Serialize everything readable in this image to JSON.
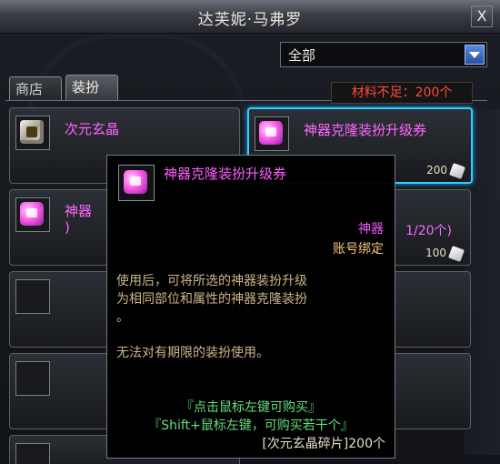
{
  "window": {
    "title": "达芙妮·马弗罗",
    "close_label": "X"
  },
  "filter": {
    "selected": "全部"
  },
  "tabs": [
    {
      "label": "商店",
      "active": false
    },
    {
      "label": "装扮",
      "active": true
    }
  ],
  "materials": {
    "status": "材料不足：200个"
  },
  "items": [
    {
      "name": "次元玄晶",
      "icon": "crystal-icon",
      "price": null
    },
    {
      "name": "神器克隆装扮升级券",
      "icon": "ticket-icon",
      "price": "200"
    },
    {
      "name_line1": "神器",
      "name_line2": ")",
      "icon": "ticket-icon",
      "sub": "1/20个)",
      "price": "100"
    }
  ],
  "tooltip": {
    "title": "神器克隆装扮升级券",
    "quality": "神器",
    "bind": "账号绑定",
    "desc_lines": [
      "使用后，可将所选的神器装扮升级",
      "为相同部位和属性的神器克隆装扮",
      "。"
    ],
    "desc2": "无法对有期限的装扮使用。",
    "hint1": "『点击鼠标左键可购买』",
    "hint2": "『Shift+鼠标左键，可购买若干个』",
    "price": "[次元玄晶碎片]200个"
  },
  "colors": {
    "accent_blue": "#2fd0ff",
    "item_purple": "#f06cff",
    "warning_red": "#ff4a3a",
    "hint_green": "#62e07a"
  }
}
